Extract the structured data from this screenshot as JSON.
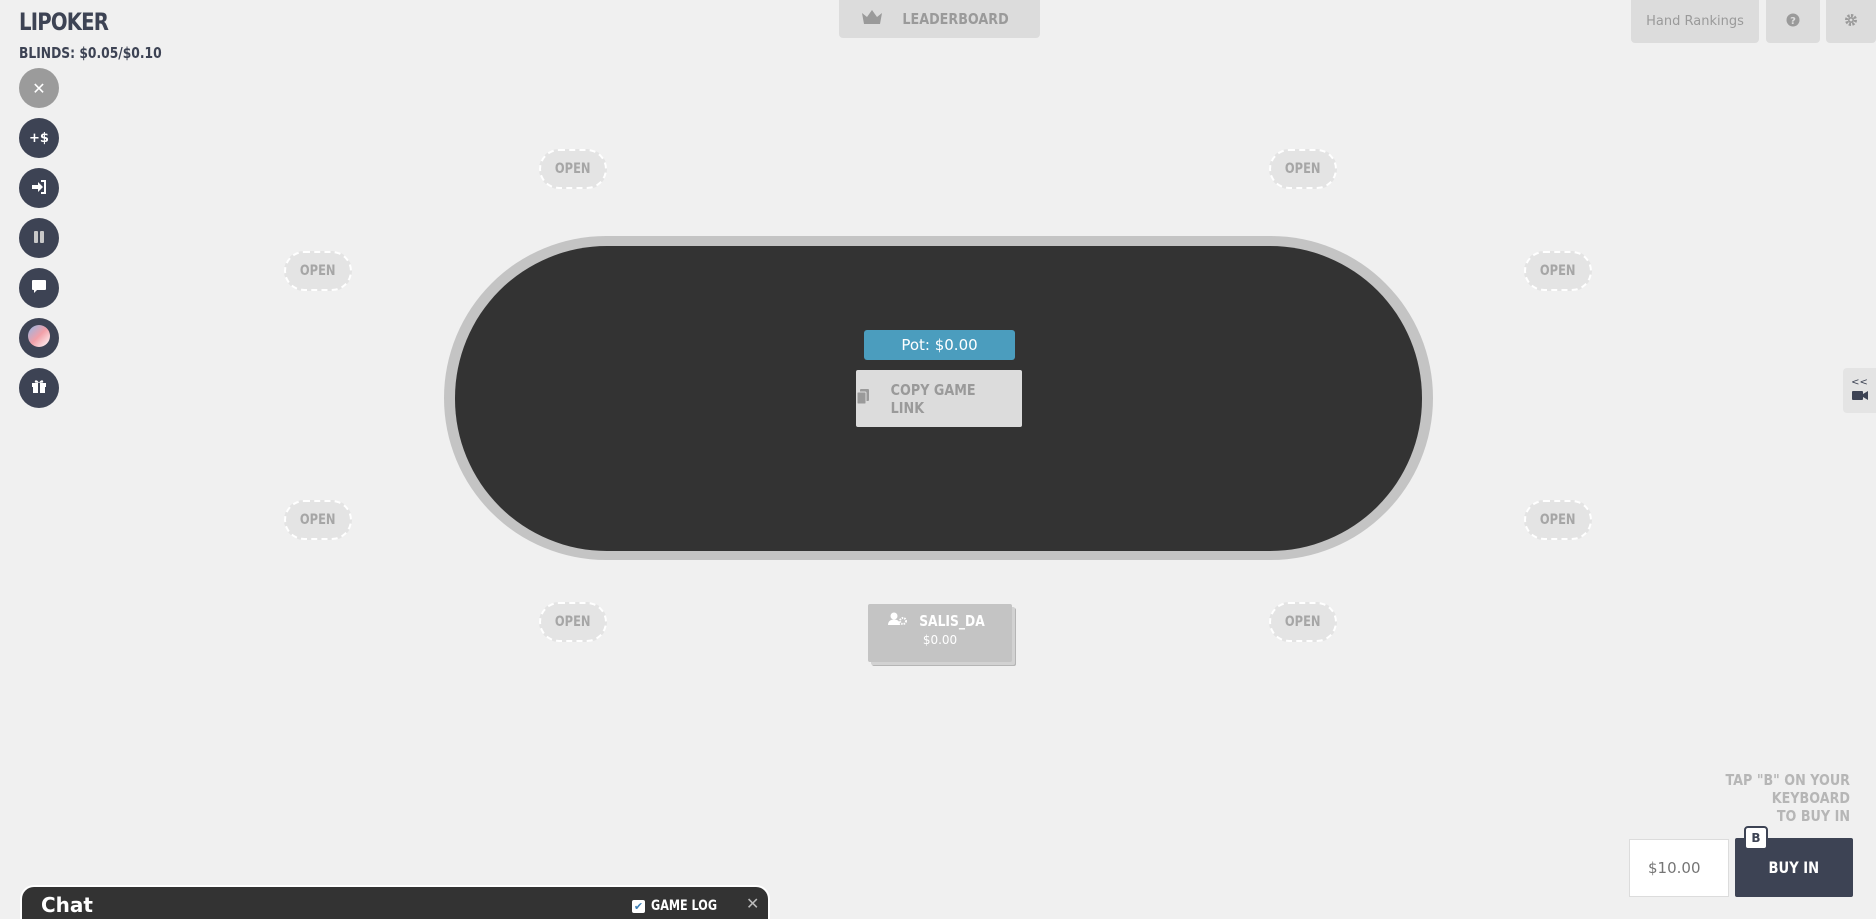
{
  "header": {
    "title": "LIPOKER",
    "blinds": "BLINDS: $0.05/$0.10"
  },
  "left_toolbar": [
    {
      "name": "close-button",
      "icon": "close-icon",
      "glyph": "✕"
    },
    {
      "name": "add-chips-button",
      "icon": "add-dollar-icon",
      "glyph": "+$"
    },
    {
      "name": "sit-in-button",
      "icon": "sign-in-icon",
      "glyph": "➜"
    },
    {
      "name": "pause-button",
      "icon": "pause-icon",
      "glyph": "❚❚"
    },
    {
      "name": "chat-toggle-button",
      "icon": "chat-bubble-icon",
      "glyph": "▬"
    },
    {
      "name": "theme-button",
      "icon": "color-gradient-icon",
      "glyph": ""
    },
    {
      "name": "gift-button",
      "icon": "gift-icon",
      "glyph": "🎁"
    }
  ],
  "top_bar": {
    "leaderboard_label": "LEADERBOARD",
    "hand_rankings_label": "Hand Rankings",
    "help_icon": "question-circle-icon",
    "settings_icon": "gear-icon"
  },
  "table": {
    "pot_label": "Pot: $0.00",
    "copy_link_label": "COPY GAME LINK"
  },
  "seats": [
    {
      "label": "OPEN"
    },
    {
      "label": "OPEN"
    },
    {
      "label": "OPEN"
    },
    {
      "label": "OPEN"
    },
    {
      "label": "OPEN"
    },
    {
      "label": "OPEN"
    },
    {
      "label": "OPEN"
    },
    {
      "label": "OPEN"
    }
  ],
  "player": {
    "name": "SALIS_DA",
    "stack": "$0.00"
  },
  "side_camera": {
    "collapse_label": "<<",
    "icon": "video-camera-icon"
  },
  "buy_in": {
    "hint_line1": "TAP \"B\" ON YOUR KEYBOARD",
    "hint_line2": "TO BUY IN",
    "amount_placeholder": "$10.00",
    "button_label": "BUY IN",
    "shortcut_key": "B"
  },
  "chat": {
    "title": "Chat",
    "game_log_label": "GAME LOG",
    "game_log_checked": true,
    "close_glyph": "✕"
  },
  "colors": {
    "background": "#f0f0f0",
    "navy": "#3d4354",
    "felt": "#333333",
    "rail": "#c4c4c4",
    "pot": "#4b9dbe"
  }
}
